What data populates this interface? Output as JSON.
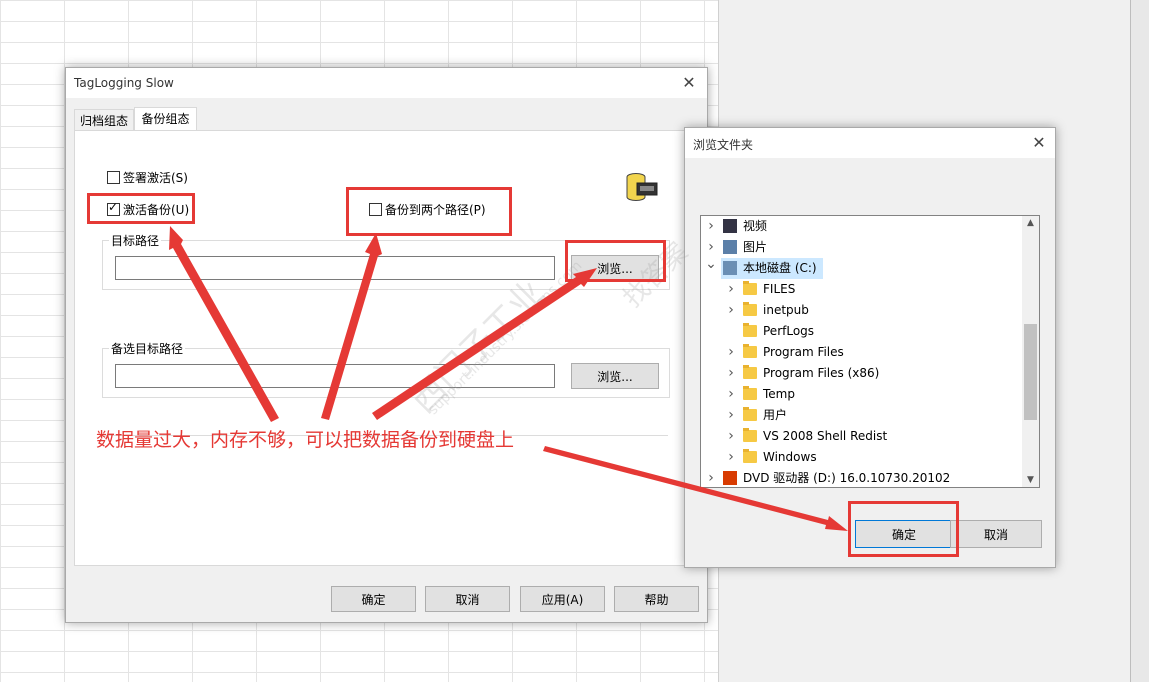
{
  "main_dialog": {
    "title": "TagLogging Slow",
    "tabs": [
      {
        "label": "归档组态"
      },
      {
        "label": "备份组态"
      }
    ],
    "checkboxes": {
      "sign_activate": {
        "label": "签署激活(S)",
        "checked": false
      },
      "activate_backup": {
        "label": "激活备份(U)",
        "checked": true
      },
      "backup_two_paths": {
        "label": "备份到两个路径(P)",
        "checked": false
      }
    },
    "target_path": {
      "title": "目标路径",
      "value": "",
      "browse_label": "浏览..."
    },
    "alt_target_path": {
      "title": "备选目标路径",
      "value": "",
      "browse_label": "浏览..."
    },
    "buttons": {
      "ok": "确定",
      "cancel": "取消",
      "apply": "应用(A)",
      "help": "帮助"
    }
  },
  "browse_dialog": {
    "title": "浏览文件夹",
    "tree": [
      {
        "label": "视频",
        "level": 0,
        "expandable": true,
        "icon": "video-icon"
      },
      {
        "label": "图片",
        "level": 0,
        "expandable": true,
        "icon": "picture-icon"
      },
      {
        "label": "本地磁盘 (C:)",
        "level": 0,
        "expanded": true,
        "selected": true,
        "icon": "drive-icon"
      },
      {
        "label": "FILES",
        "level": 1,
        "expandable": true,
        "icon": "folder-icon"
      },
      {
        "label": "inetpub",
        "level": 1,
        "expandable": true,
        "icon": "folder-icon"
      },
      {
        "label": "PerfLogs",
        "level": 1,
        "expandable": false,
        "icon": "folder-icon"
      },
      {
        "label": "Program Files",
        "level": 1,
        "expandable": true,
        "icon": "folder-icon"
      },
      {
        "label": "Program Files (x86)",
        "level": 1,
        "expandable": true,
        "icon": "folder-icon"
      },
      {
        "label": "Temp",
        "level": 1,
        "expandable": true,
        "icon": "folder-icon"
      },
      {
        "label": "用户",
        "level": 1,
        "expandable": true,
        "icon": "folder-icon"
      },
      {
        "label": "VS 2008 Shell Redist",
        "level": 1,
        "expandable": true,
        "icon": "folder-icon"
      },
      {
        "label": "Windows",
        "level": 1,
        "expandable": true,
        "icon": "folder-icon"
      },
      {
        "label": "DVD 驱动器 (D:) 16.0.10730.20102",
        "level": 0,
        "expandable": true,
        "icon": "office-icon"
      }
    ],
    "buttons": {
      "ok": "确定",
      "cancel": "取消"
    }
  },
  "annotation": {
    "text": "数据量过大，内存不够，可以把数据备份到硬盘上",
    "color": "#e53935"
  },
  "watermark": {
    "line1": "西门子工业",
    "line2": "support.industry.siemens.com",
    "line3": "找答案"
  }
}
